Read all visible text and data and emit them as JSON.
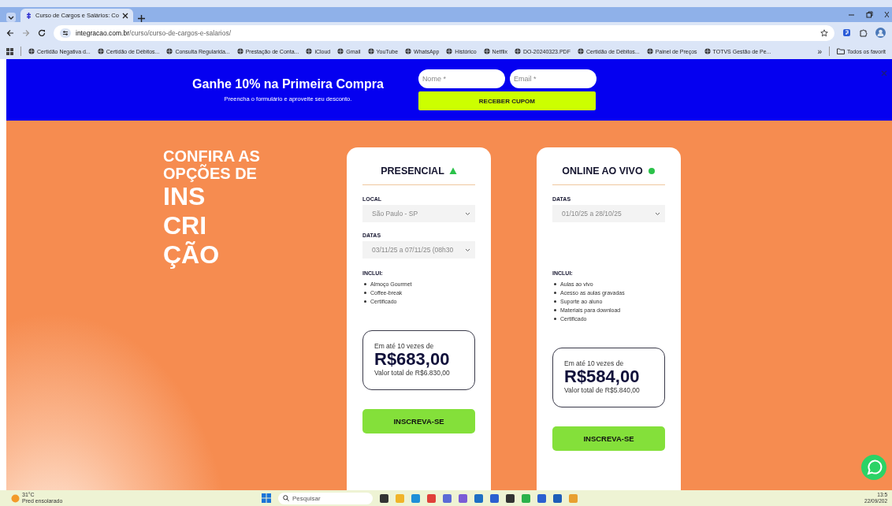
{
  "browser": {
    "tab": {
      "title": "Curso de Cargos e Salários: Co",
      "selected": true
    },
    "address": {
      "host": "integracao.com.br",
      "path": "/curso/curso-de-cargos-e-salarios/"
    },
    "bookmarks": [
      {
        "label": "Certidão Negativa d..."
      },
      {
        "label": "Certidão de Débitos..."
      },
      {
        "label": "Consulta Regularida..."
      },
      {
        "label": "Prestação de Conta..."
      },
      {
        "label": "iCloud"
      },
      {
        "label": "Gmail"
      },
      {
        "label": "YouTube"
      },
      {
        "label": "WhatsApp"
      },
      {
        "label": "Histórico"
      },
      {
        "label": "Netflix"
      },
      {
        "label": "DO-20240323.PDF"
      },
      {
        "label": "Certidão de Débitos..."
      },
      {
        "label": "Painel de Preços"
      },
      {
        "label": "TOTVS Gestão de Pe..."
      }
    ],
    "overflow": "»",
    "all_bookmarks": "Todos os favorit"
  },
  "banner": {
    "title": "Ganhe 10% na Primeira Compra",
    "subtitle": "Preencha o formulário e aproveite seu desconto.",
    "name_placeholder": "Nome *",
    "email_placeholder": "Email *",
    "button": "RECEBER CUPOM"
  },
  "hero": {
    "heading": [
      "CONFIRA AS",
      "OPÇÕES DE"
    ],
    "big": [
      "INS",
      "CRI",
      "ÇÃO"
    ]
  },
  "cards": [
    {
      "title": "PRESENCIAL",
      "kind": "triangle",
      "fields": [
        {
          "label": "LOCAL",
          "value": "São Paulo - SP"
        },
        {
          "label": "DATAS",
          "value": "03/11/25 a 07/11/25 (08h30"
        }
      ],
      "includes_label": "INCLUI:",
      "includes": [
        "Almoço Gourmet",
        "Coffee-break",
        "Certificado"
      ],
      "installments": "Em até 10 vezes de",
      "price": "R$683,00",
      "total": "Valor total de R$6.830,00",
      "button": "INSCREVA-SE"
    },
    {
      "title": "ONLINE AO VIVO",
      "kind": "dot",
      "fields": [
        {
          "label": "DATAS",
          "value": "01/10/25 a 28/10/25"
        }
      ],
      "includes_label": "INCLUI:",
      "includes": [
        "Aulas ao vivo",
        "Acesso as aulas gravadas",
        "Suporte ao aluno",
        "Materiais para download",
        "Certificado"
      ],
      "installments": "Em até 10 vezes de",
      "price": "R$584,00",
      "total": "Valor total de R$5.840,00",
      "button": "INSCREVA-SE"
    }
  ],
  "taskbar": {
    "temperature": "31°C",
    "condition": "Pred ensolarado",
    "search_placeholder": "Pesquisar",
    "time": "13:5",
    "date": "22/09/202"
  }
}
